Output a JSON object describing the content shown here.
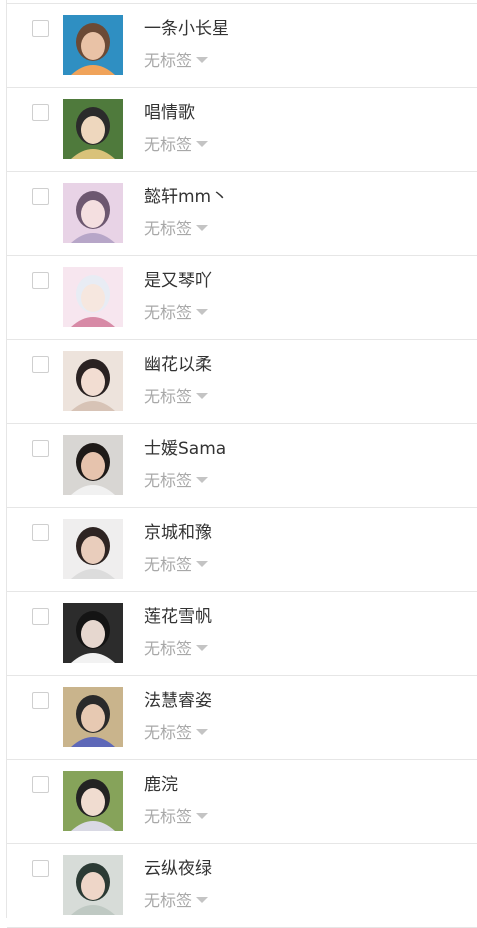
{
  "contacts": [
    {
      "name": "一条小长星",
      "tag": "无标签",
      "avatar_colors": [
        "#2f8fc2",
        "#e9c2a6",
        "#6b4a36",
        "#f0a35a"
      ]
    },
    {
      "name": "唱情歌",
      "tag": "无标签",
      "avatar_colors": [
        "#4f7a3c",
        "#eed7be",
        "#2b2b2b",
        "#d9c27a"
      ]
    },
    {
      "name": "懿轩mm丶",
      "tag": "无标签",
      "avatar_colors": [
        "#e8d3e6",
        "#f4dfe0",
        "#6d5870",
        "#b7a6c8"
      ]
    },
    {
      "name": "是又琴吖",
      "tag": "无标签",
      "avatar_colors": [
        "#f7e6ef",
        "#f6e7df",
        "#e8ecf4",
        "#d78aa6"
      ]
    },
    {
      "name": "幽花以柔",
      "tag": "无标签",
      "avatar_colors": [
        "#ede3dc",
        "#f2ddd2",
        "#2a2222",
        "#d7c3b6"
      ]
    },
    {
      "name": "士媛Sama",
      "tag": "无标签",
      "avatar_colors": [
        "#d8d6d3",
        "#e6c3ad",
        "#1e1a18",
        "#f1f1f1"
      ]
    },
    {
      "name": "京城和豫",
      "tag": "无标签",
      "avatar_colors": [
        "#efeeee",
        "#e9cdbc",
        "#2e2422",
        "#dcdcdc"
      ]
    },
    {
      "name": "莲花雪帆",
      "tag": "无标签",
      "avatar_colors": [
        "#2c2c2c",
        "#e6d7cf",
        "#141414",
        "#f2f2f2"
      ]
    },
    {
      "name": "法慧睿姿",
      "tag": "无标签",
      "avatar_colors": [
        "#c9b48c",
        "#e7c9b2",
        "#2a2a2a",
        "#5e68b8"
      ]
    },
    {
      "name": "鹿浣",
      "tag": "无标签",
      "avatar_colors": [
        "#86a35a",
        "#f0dcd0",
        "#232323",
        "#d9d9e4"
      ]
    },
    {
      "name": "云纵夜绿",
      "tag": "无标签",
      "avatar_colors": [
        "#d7dcd8",
        "#eed6c8",
        "#2b3a34",
        "#bfc9c3"
      ]
    }
  ]
}
